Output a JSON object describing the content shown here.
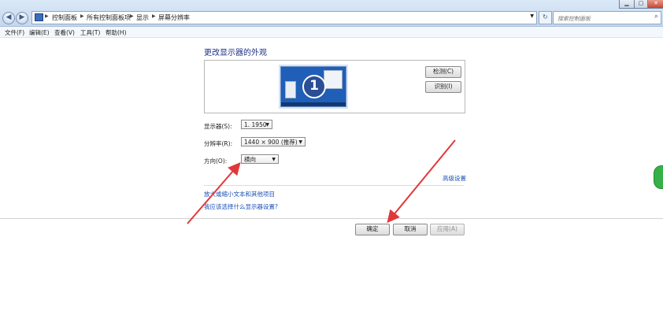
{
  "address": {
    "segments": [
      "控制面板",
      "所有控制面板项",
      "显示",
      "屏幕分辨率"
    ]
  },
  "search": {
    "placeholder": "搜索控制面板"
  },
  "menu": {
    "items": [
      "文件(F)",
      "编辑(E)",
      "查看(V)",
      "工具(T)",
      "帮助(H)"
    ]
  },
  "main": {
    "title": "更改显示器的外观",
    "monitor_number": "1",
    "detect_label": "检测(C)",
    "identify_label": "识别(I)",
    "display_label": "显示器(S):",
    "display_value": "1. 1950",
    "resolution_label": "分辨率(R):",
    "resolution_value": "1440 × 900 (推荐)",
    "orientation_label": "方向(O):",
    "orientation_value": "横向",
    "advanced_link": "高级设置",
    "link_text_size": "放大或缩小文本和其他项目",
    "link_which_settings": "我应该选择什么显示器设置?"
  },
  "footer": {
    "ok_label": "确定",
    "cancel_label": "取消",
    "apply_label": "应用(A)"
  },
  "colors": {
    "arrow": "#e0383a",
    "link": "#1a4fb5",
    "title": "#1e3287",
    "monitor": "#1f5fb8"
  }
}
